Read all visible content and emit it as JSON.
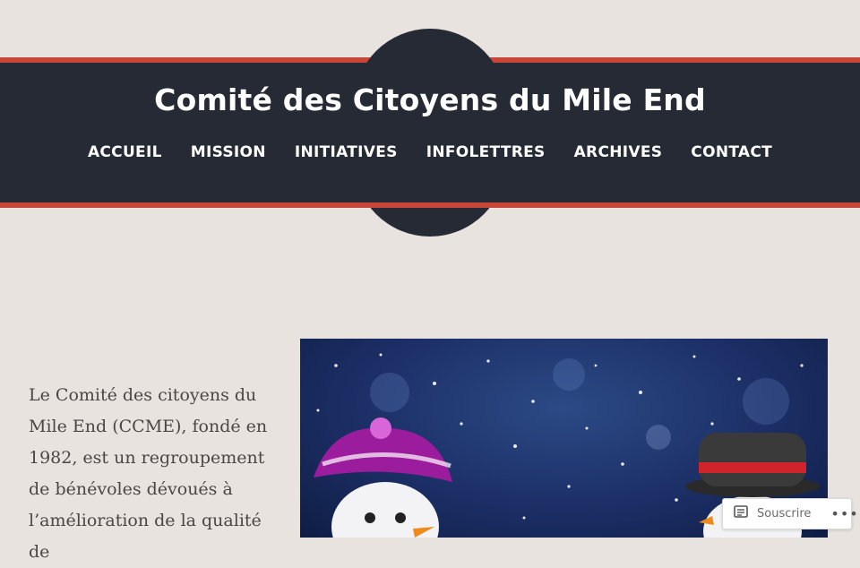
{
  "site": {
    "title": "Comité des Citoyens du Mile End"
  },
  "nav": {
    "items": [
      {
        "label": "ACCUEIL"
      },
      {
        "label": "MISSION"
      },
      {
        "label": "INITIATIVES"
      },
      {
        "label": "INFOLETTRES"
      },
      {
        "label": "ARCHIVES"
      },
      {
        "label": "CONTACT"
      }
    ]
  },
  "main": {
    "intro_text": "Le Comité des citoyens du Mile End (CCME), fondé en 1982, est un regroupement de bénévoles dévoués à l’amélioration de la qualité de"
  },
  "subscribe": {
    "label": "Souscrire",
    "icon": "reader-icon",
    "more": "•••"
  },
  "colors": {
    "background": "#e8e3de",
    "header": "#252a34",
    "accent": "#c8473a"
  }
}
